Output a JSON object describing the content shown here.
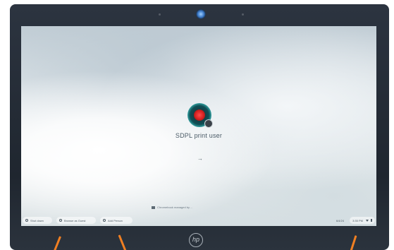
{
  "login": {
    "user_name": "SDPL print user",
    "submit_glyph": "→",
    "managed_note": "Chromebook managed by ..."
  },
  "shelf": {
    "shutdown_label": "Shut down",
    "guest_label": "Browse as Guest",
    "add_person_label": "Add Person"
  },
  "status": {
    "date": "6/4/24",
    "time": "3:35 PM"
  },
  "device": {
    "logo_text": "hp"
  },
  "icons": {
    "avatar": "user-avatar-icon",
    "submit": "arrow-right-icon",
    "managed": "building-icon",
    "shutdown": "power-icon",
    "guest": "guest-icon",
    "add_person": "add-person-icon",
    "wifi": "wifi-icon",
    "battery": "battery-icon"
  },
  "colors": {
    "annotation_marker": "#f07f22",
    "avatar_accent": "#3fb7b6",
    "avatar_core": "#d42020"
  }
}
